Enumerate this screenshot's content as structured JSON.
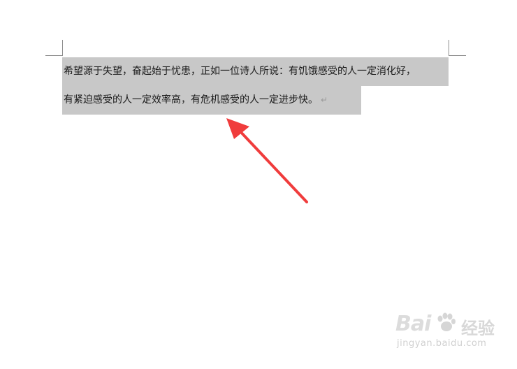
{
  "document": {
    "line1": "希望源于失望，奋起始于忧患，正如一位诗人所说：有饥饿感受的人一定消化好，",
    "line2": "有紧迫感受的人一定效率高，有危机感受的人一定进步快。",
    "paragraph_mark": "↵"
  },
  "annotation": {
    "arrow_color": "#f03c3c"
  },
  "watermark": {
    "logo": "Bai",
    "name": "经验",
    "url": "jingyan.baidu.com"
  },
  "colors": {
    "selection": "#c8c8c8",
    "text": "#1a1a1a",
    "crop_marks": "#8c8c8c"
  }
}
